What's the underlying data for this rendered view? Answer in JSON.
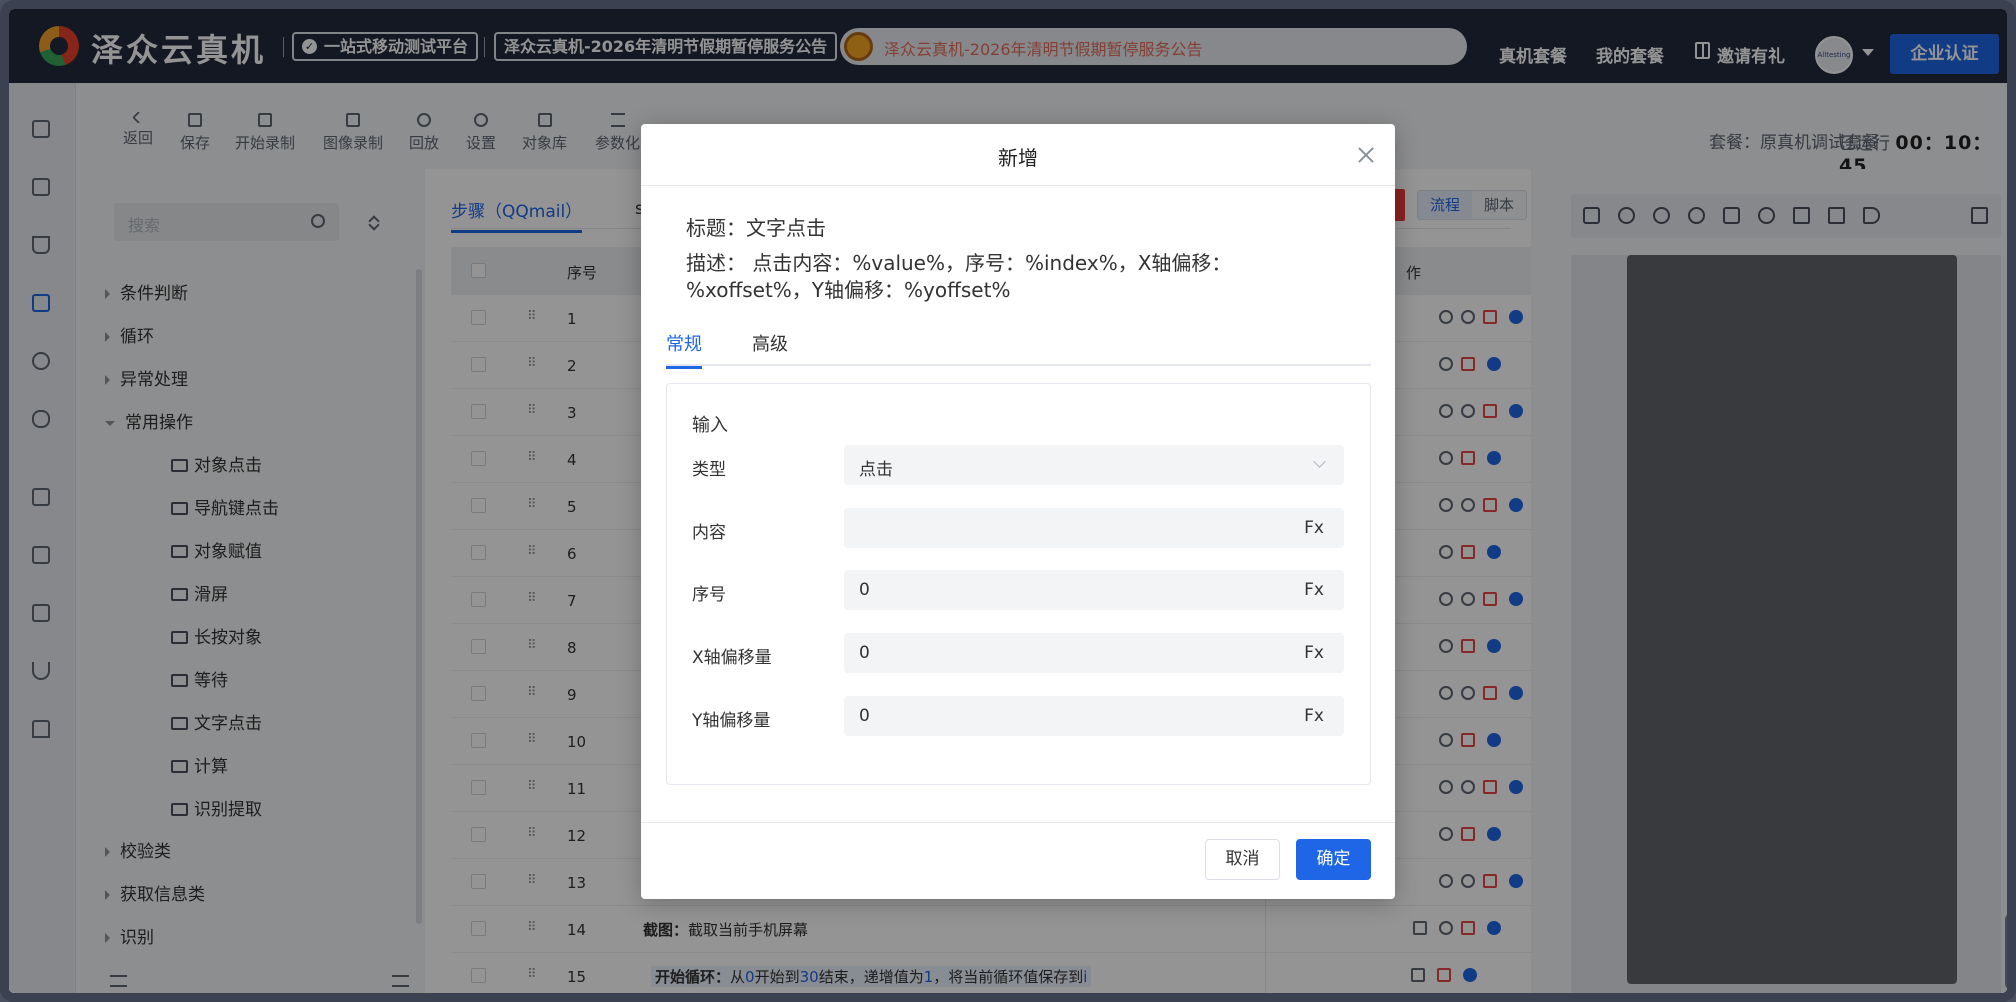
{
  "header": {
    "logo_text": "泽众云真机",
    "slogan": "一站式移动测试平台",
    "announcement_badge": "泽众云真机-2026年清明节假期暂停服务公告",
    "notice_text": "泽众云真机-2026年清明节假期暂停服务公告",
    "nav": [
      "真机套餐",
      "我的套餐",
      "邀请有礼"
    ],
    "avatar_text": "Alltesting",
    "enterprise_button": "企业认证"
  },
  "toolbar": {
    "items": [
      "返回",
      "保存",
      "开始录制",
      "图像录制",
      "回放",
      "设置",
      "对象库",
      "参数化"
    ],
    "plan_text": "套餐：原真机调试套餐",
    "runtime_label": "已运行",
    "runtime_value": "00：10：45"
  },
  "left_panel": {
    "search_placeholder": "搜索",
    "tree": {
      "cond": "条件判断",
      "loop": "循环",
      "exception": "异常处理",
      "common": "常用操作",
      "verify": "校验类",
      "getinfo": "获取信息类",
      "recognize": "识别"
    },
    "leaves": [
      "对象点击",
      "导航键点击",
      "对象赋值",
      "滑屏",
      "长按对象",
      "等待",
      "文字点击",
      "计算",
      "识别提取"
    ]
  },
  "main": {
    "step_tab": "步骤（QQmail）",
    "tab2_initial": "s",
    "seg": [
      "流程",
      "脚本"
    ],
    "col_index": "序号",
    "col_ops": "作",
    "rows": [
      "1",
      "2",
      "3",
      "4",
      "5",
      "6",
      "7",
      "8",
      "9",
      "10",
      "11",
      "12",
      "13",
      "14",
      "15"
    ],
    "row14_prefix": "截图：",
    "row14_text": "截取当前手机屏幕",
    "row15_prefix": "开始循环：",
    "row15_a": "从",
    "row15_b": "0",
    "row15_c": "开始到",
    "row15_d": "30",
    "row15_e": "结束，递增值为",
    "row15_f": "1",
    "row15_g": "，将当前循环值保存到",
    "row15_h": "i"
  },
  "modal": {
    "title": "新增",
    "step_title": "标题：文字点击",
    "step_desc": "描述： 点击内容：%value%，序号：%index%，X轴偏移：%xoffset%，Y轴偏移：%yoffset%",
    "tabs": [
      "常规",
      "高级"
    ],
    "section": "输入",
    "fields": {
      "type_label": "类型",
      "type_value": "点击",
      "content_label": "内容",
      "content_value": "",
      "index_label": "序号",
      "index_value": "0",
      "xoff_label": "X轴偏移量",
      "xoff_value": "0",
      "yoff_label": "Y轴偏移量",
      "yoff_value": "0",
      "fx": "Fx"
    },
    "cancel": "取消",
    "confirm": "确定"
  },
  "colors": {
    "accent": "#1f66e6",
    "topbar": "#222a3c",
    "danger": "#e64545"
  }
}
